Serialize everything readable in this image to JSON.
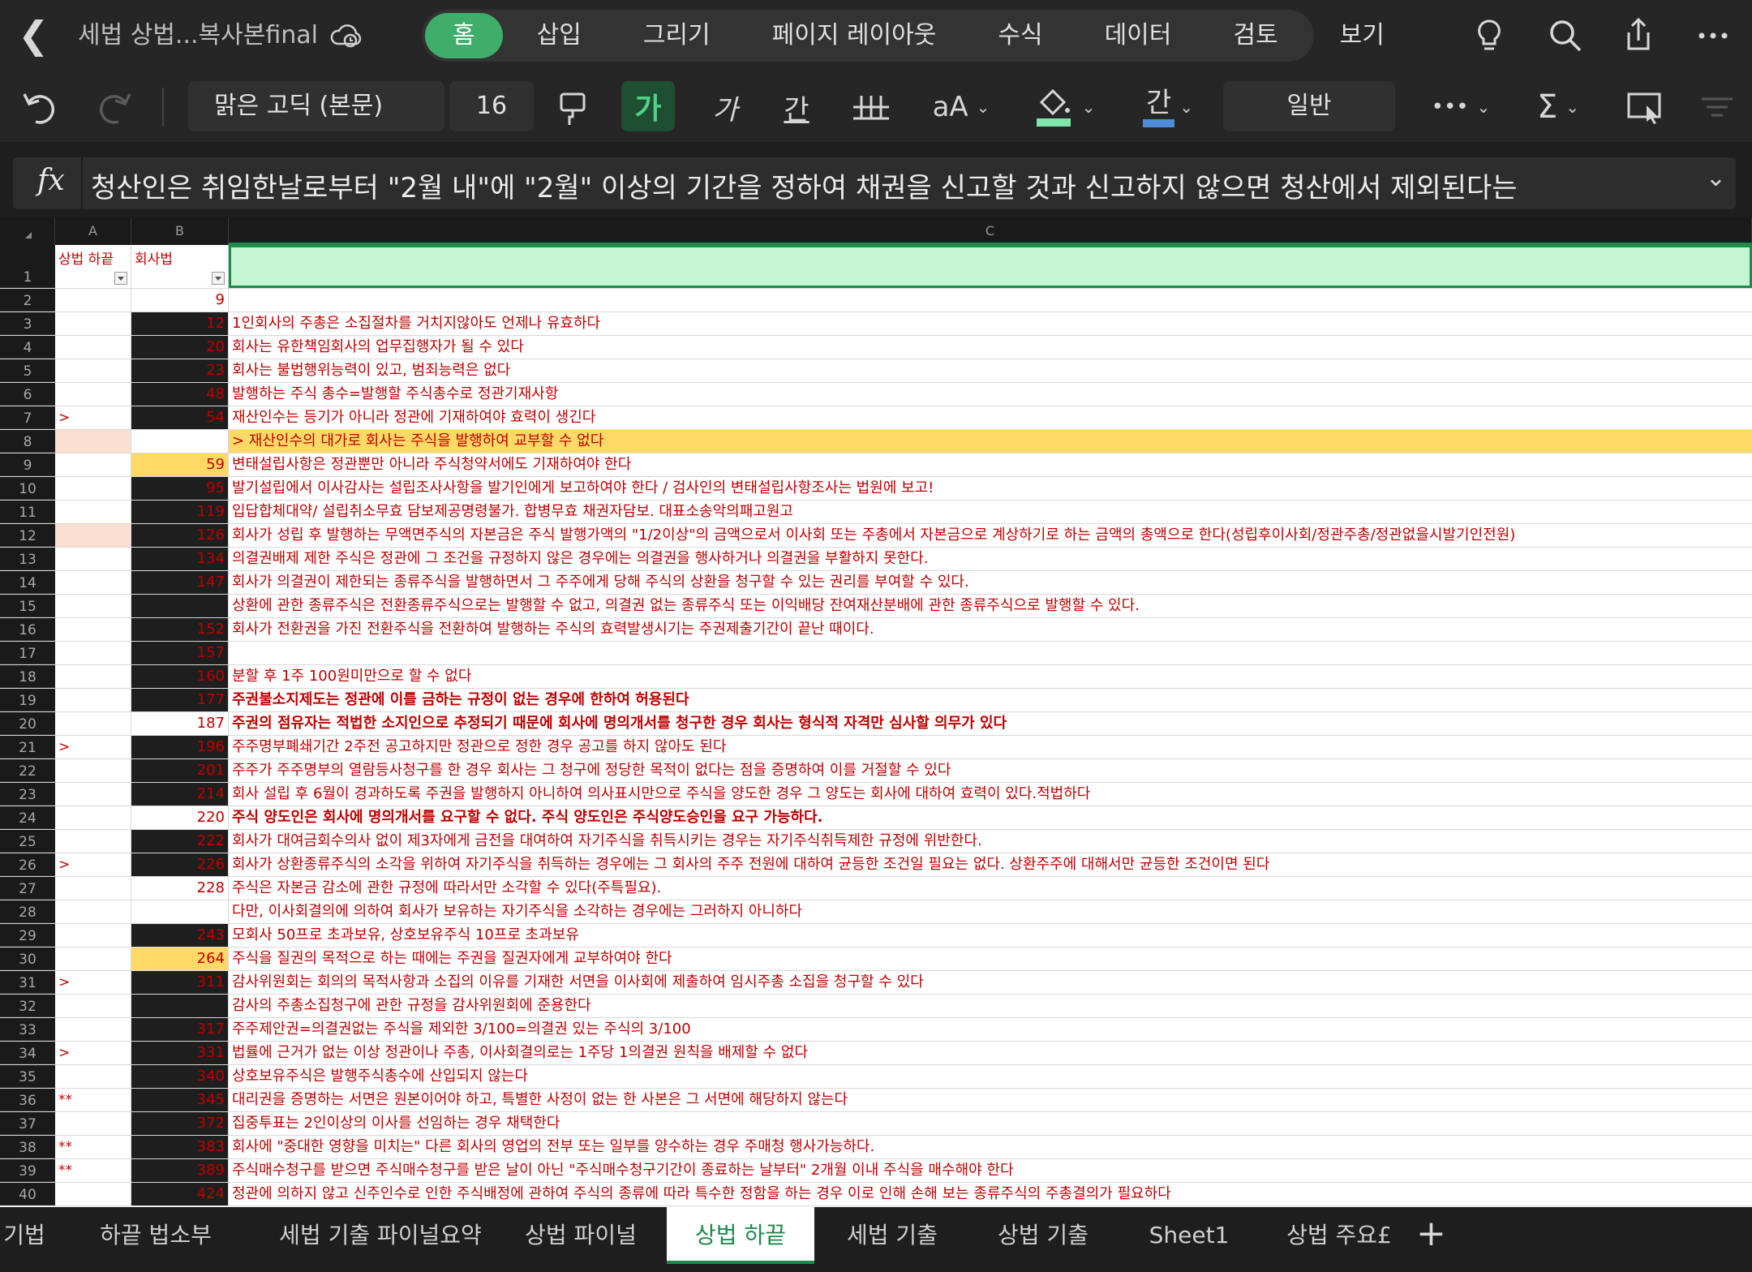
{
  "titlebar": {
    "doc_title": "세법 상법...복사본final",
    "tabs": [
      "홈",
      "삽입",
      "그리기",
      "페이지 레이아웃",
      "수식",
      "데이터",
      "검토",
      "보기"
    ],
    "active_tab": "홈"
  },
  "toolbar": {
    "font_name": "맑은 고딕 (본문)",
    "font_size": "16",
    "bold_label": "가",
    "italic_label": "가",
    "underline_label": "간",
    "font_scale_label": "aA",
    "font_color_label": "간",
    "number_format": "일반",
    "more_label": "•••",
    "sum_label": "Σ"
  },
  "formula_bar": {
    "fx": "fx",
    "text": "청산인은 취임한날로부터 \"2월 내\"에 \"2월\" 이상의 기간을 정하여 채권을 신고할 것과 신고하지 않으면 청산에서 제외된다는"
  },
  "columns": [
    "A",
    "B",
    "C"
  ],
  "header_row": {
    "a": "상법 하끝",
    "b": "회사법",
    "c": ""
  },
  "rows": [
    {
      "n": "2",
      "a": "",
      "b": "9",
      "c": "",
      "bstyle": "white"
    },
    {
      "n": "3",
      "a": "",
      "b": "12",
      "c": "1인회사의 주총은 소집절차를 거치지않아도 언제나 유효하다",
      "bstyle": "dark"
    },
    {
      "n": "4",
      "a": "",
      "b": "20",
      "c": "회사는 유한책임회사의 업무집행자가 될 수 있다",
      "bstyle": "dark"
    },
    {
      "n": "5",
      "a": "",
      "b": "23",
      "c": "회사는 불법행위능력이 있고, 범죄능력은 없다",
      "bstyle": "dark"
    },
    {
      "n": "6",
      "a": "",
      "b": "48",
      "c": "발행하는 주식 총수=발행할 주식총수로 정관기재사항",
      "bstyle": "dark"
    },
    {
      "n": "7",
      "a": ">",
      "b": "54",
      "c": "재산인수는 등기가 아니라 정관에 기재하여야 효력이 생긴다",
      "bstyle": "dark"
    },
    {
      "n": "8",
      "a": "",
      "b": "",
      "c": "> 재산인수의 대가로 회사는 주식을 발행하여 교부할 수 없다",
      "bstyle": "yellowrow"
    },
    {
      "n": "9",
      "a": "",
      "b": "59",
      "c": "변태설립사항은 정관뿐만 아니라 주식청약서에도 기재하여야 한다",
      "bstyle": "yellow"
    },
    {
      "n": "10",
      "a": "",
      "b": "95",
      "c": "발기설립에서 이사감사는 설립조사사항을 발기인에게 보고하여야 한다 / 검사인의 변태설립사항조사는 법원에 보고!",
      "bstyle": "dark"
    },
    {
      "n": "11",
      "a": "",
      "b": "119",
      "c": "입답합체대약/ 설립취소무효 담보제공명령불가. 합병무효 채권자담보. 대표소송악의패고원고",
      "bstyle": "dark"
    },
    {
      "n": "12",
      "a": "",
      "b": "126",
      "c": "회사가 성립 후 발행하는 무액면주식의 자본금은 주식 발행가액의 \"1/2이상\"의 금액으로서 이사회 또는 주총에서 자본금으로 계상하기로 하는 금액의 총액으로 한다(성립후이사회/정관주총/정관없을시발기인전원)",
      "bstyle": "dark",
      "apeach": true
    },
    {
      "n": "13",
      "a": "",
      "b": "134",
      "c": "의결권배제 제한 주식은 정관에 그 조건을 규정하지 않은 경우에는 의결권을 행사하거나 의결권을 부활하지 못한다.",
      "bstyle": "dark"
    },
    {
      "n": "14",
      "a": "",
      "b": "147",
      "c": "회사가 의결권이 제한되는 종류주식을 발행하면서 그 주주에게 당해 주식의 상환을 청구할 수 있는 권리를 부여할 수 있다.",
      "bstyle": "dark"
    },
    {
      "n": "15",
      "a": "",
      "b": "",
      "c": "상환에 관한 종류주식은 전환종류주식으로는 발행할 수 없고, 의결권 없는 종류주식 또는 이익배당 잔여재산분배에 관한 종류주식으로 발행할 수 있다.",
      "bstyle": "dark"
    },
    {
      "n": "16",
      "a": "",
      "b": "152",
      "c": "회사가 전환권을 가진 전환주식을 전환하여 발행하는 주식의 효력발생시기는 주권제출기간이 끝난 때이다.",
      "bstyle": "dark"
    },
    {
      "n": "17",
      "a": "",
      "b": "157",
      "c": "",
      "bstyle": "dark"
    },
    {
      "n": "18",
      "a": "",
      "b": "160",
      "c": "분할 후 1주 100원미만으로 할 수 없다",
      "bstyle": "dark"
    },
    {
      "n": "19",
      "a": "",
      "b": "177",
      "c": "주권불소지제도는 정관에 이를 금하는 규정이 없는 경우에 한하여 허용된다",
      "bstyle": "dark",
      "bold": true
    },
    {
      "n": "20",
      "a": "",
      "b": "187",
      "c": "주권의 점유자는 적법한 소지인으로 추정되기 때문에 회사에 명의개서를 청구한 경우 회사는 형식적 자격만 심사할 의무가 있다",
      "bstyle": "white",
      "bold": true
    },
    {
      "n": "21",
      "a": ">",
      "b": "196",
      "c": "주주명부폐쇄기간 2주전 공고하지만 정관으로 정한 경우 공고를 하지 않아도 된다",
      "bstyle": "dark"
    },
    {
      "n": "22",
      "a": "",
      "b": "201",
      "c": "주주가 주주명부의 열람등사청구를 한 경우 회사는 그 청구에 정당한 목적이 없다는 점을 증명하여 이를 거절할 수 있다",
      "bstyle": "dark"
    },
    {
      "n": "23",
      "a": "",
      "b": "214",
      "c": "회사 설립 후 6월이 경과하도록 주권을 발행하지 아니하여 의사표시만으로 주식을 양도한 경우 그 양도는 회사에 대하여 효력이 있다.적법하다",
      "bstyle": "dark"
    },
    {
      "n": "24",
      "a": "",
      "b": "220",
      "c": "주식 양도인은 회사에 명의개서를 요구할 수 없다. 주식 양도인은 주식양도승인을 요구 가능하다.",
      "bstyle": "white",
      "bold": true
    },
    {
      "n": "25",
      "a": "",
      "b": "222",
      "c": "회사가 대여금회수의사 없이 제3자에게 금전을 대여하여 자기주식을 취득시키는 경우는 자기주식취득제한 규정에 위반한다.",
      "bstyle": "dark"
    },
    {
      "n": "26",
      "a": ">",
      "b": "226",
      "c": "회사가 상환종류주식의 소각을 위하여 자기주식을 취득하는 경우에는 그 회사의 주주 전원에 대하여 균등한 조건일 필요는 없다. 상환주주에 대해서만 균등한 조건이면 된다",
      "bstyle": "dark"
    },
    {
      "n": "27",
      "a": "",
      "b": "228",
      "c": "주식은 자본금 감소에 관한 규정에 따라서만 소각할 수 있다(주특필요).",
      "bstyle": "white"
    },
    {
      "n": "28",
      "a": "",
      "b": "",
      "c": "다만, 이사회결의에 의하여 회사가 보유하는 자기주식을 소각하는 경우에는 그러하지 아니하다",
      "bstyle": "white"
    },
    {
      "n": "29",
      "a": "",
      "b": "243",
      "c": "모회사 50프로 초과보유, 상호보유주식 10프로 초과보유",
      "bstyle": "dark"
    },
    {
      "n": "30",
      "a": "",
      "b": "264",
      "c": "주식을 질권의 목적으로 하는 때에는 주권을 질권자에게 교부하여야 한다",
      "bstyle": "yellow"
    },
    {
      "n": "31",
      "a": ">",
      "b": "311",
      "c": "감사위원회는 회의의 목적사항과 소집의 이유를 기재한 서면을 이사회에 제출하여 임시주총 소집을 청구할 수 있다",
      "bstyle": "dark"
    },
    {
      "n": "32",
      "a": "",
      "b": "",
      "c": "감사의 주총소집청구에 관한 규정을 감사위원회에 준용한다",
      "bstyle": "dark"
    },
    {
      "n": "33",
      "a": "",
      "b": "317",
      "c": "주주제안권=의결권없는 주식을 제외한 3/100=의결권 있는 주식의 3/100",
      "bstyle": "dark"
    },
    {
      "n": "34",
      "a": ">",
      "b": "331",
      "c": "법률에 근거가 없는 이상 정관이나 주총, 이사회결의로는 1주당 1의결권 원칙을 배제할 수 없다",
      "bstyle": "dark"
    },
    {
      "n": "35",
      "a": "",
      "b": "340",
      "c": "상호보유주식은 발행주식총수에 산입되지 않는다",
      "bstyle": "dark"
    },
    {
      "n": "36",
      "a": "**",
      "b": "345",
      "c": "대리권을 증명하는 서면은 원본이어야 하고, 특별한 사정이 없는 한 사본은 그 서면에 해당하지 않는다",
      "bstyle": "dark"
    },
    {
      "n": "37",
      "a": "",
      "b": "372",
      "c": "집중투표는 2인이상의 이사를 선임하는 경우 채택한다",
      "bstyle": "dark"
    },
    {
      "n": "38",
      "a": "**",
      "b": "383",
      "c": "회사에 \"중대한 영향을 미치는\" 다른 회사의 영업의 전부 또는 일부를 양수하는 경우 주매청 행사가능하다.",
      "bstyle": "dark"
    },
    {
      "n": "39",
      "a": "**",
      "b": "389",
      "c": "주식매수청구를 받으면 주식매수청구를 받은 날이 아닌 \"주식매수청구기간이 종료하는 날부터\" 2개월 이내 주식을 매수해야 한다",
      "bstyle": "dark"
    },
    {
      "n": "40",
      "a": "",
      "b": "424",
      "c": "정관에 의하지 않고 신주인수로 인한 주식배정에 관하여 주식의 종류에 따라 특수한 정함을 하는 경우 이로 인해 손해 보는 종류주식의 주총결의가 필요하다",
      "bstyle": "dark"
    }
  ],
  "sheet_tabs": [
    "기법",
    "하끝 법소부",
    "세법 기출 파이널요약",
    "상법 파이널",
    "상법 하끝",
    "세법 기출",
    "상법 기출",
    "Sheet1",
    "상법 주요£"
  ],
  "active_sheet": "상법 하끝",
  "colors": {
    "accent": "#3fae6a",
    "cell_text": "#c00000",
    "highlight": "#ffd966",
    "selected": "#c6f5d3"
  }
}
